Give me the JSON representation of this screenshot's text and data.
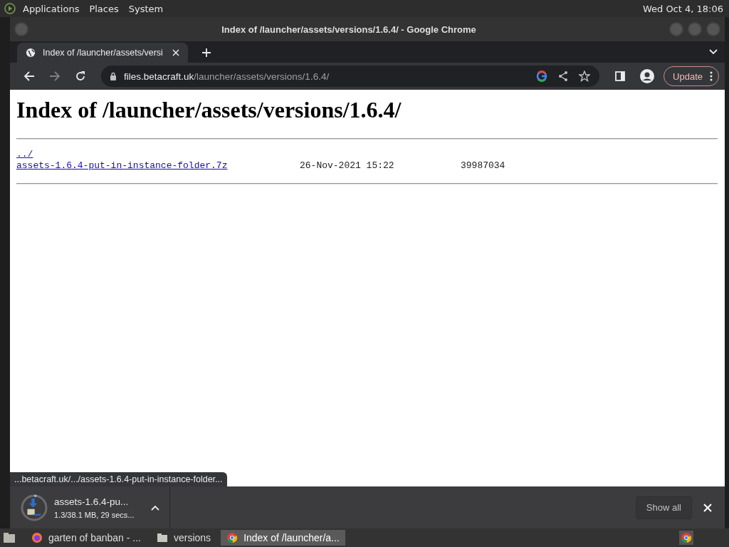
{
  "top_panel": {
    "menus": [
      "Applications",
      "Places",
      "System"
    ],
    "clock": "Wed Oct  4, 18:06"
  },
  "window": {
    "title": "Index of /launcher/assets/versions/1.6.4/ - Google Chrome"
  },
  "tabs": [
    {
      "label": "Index of /launcher/assets/versi",
      "selected": true
    }
  ],
  "address_bar": {
    "domain": "files.betacraft.uk",
    "path": "/launcher/assets/versions/1.6.4/"
  },
  "update_button": "Update",
  "page": {
    "heading": "Index of /launcher/assets/versions/1.6.4/",
    "entries": [
      {
        "name": "../"
      },
      {
        "name": "assets-1.6.4-put-in-instance-folder.7z",
        "date": "26-Nov-2021 15:22",
        "size": "39987034"
      }
    ]
  },
  "status_bubble": "...betacraft.uk/.../assets-1.6.4-put-in-instance-folder...",
  "download": {
    "file": "assets-1.6.4-pu...",
    "progress": "1.3/38.1 MB, 29 secs...",
    "level": 0.034
  },
  "show_all": "Show all",
  "taskbar": [
    {
      "label": "garten of banban - ...",
      "kind": "browser",
      "selected": false
    },
    {
      "label": "versions",
      "kind": "folder",
      "selected": false
    },
    {
      "label": "Index of /launcher/a...",
      "kind": "chrome",
      "selected": true
    }
  ]
}
